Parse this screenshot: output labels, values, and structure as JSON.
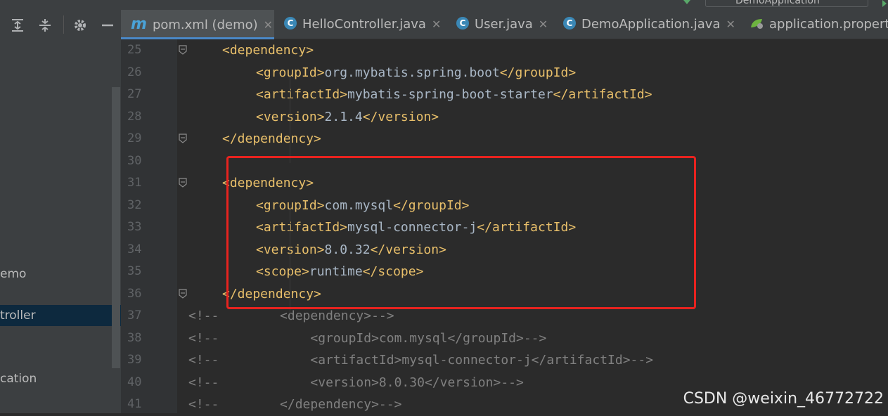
{
  "run_config": "DemoApplication",
  "project_tree": {
    "items": [
      {
        "label": "emo",
        "selected": false
      },
      {
        "label": "troller",
        "selected": true
      },
      {
        "label": "cation",
        "selected": false
      }
    ]
  },
  "tabs": [
    {
      "label": "pom.xml (demo)",
      "icon": "maven-icon",
      "active": true
    },
    {
      "label": "HelloController.java",
      "icon": "class-icon",
      "active": false
    },
    {
      "label": "User.java",
      "icon": "class-icon",
      "active": false
    },
    {
      "label": "DemoApplication.java",
      "icon": "spring-class-icon",
      "active": false
    },
    {
      "label": "application.propert",
      "icon": "spring-properties-icon",
      "active": false
    }
  ],
  "editor": {
    "lines": [
      {
        "num": "25",
        "indent": 4,
        "parts": [
          [
            "tag",
            "<dependency>"
          ]
        ]
      },
      {
        "num": "26",
        "indent": 8,
        "parts": [
          [
            "tag",
            "<groupId>"
          ],
          [
            "txt",
            "org.mybatis.spring.boot"
          ],
          [
            "tag",
            "</groupId>"
          ]
        ]
      },
      {
        "num": "27",
        "indent": 8,
        "parts": [
          [
            "tag",
            "<artifactId>"
          ],
          [
            "txt",
            "mybatis-spring-boot-starter"
          ],
          [
            "tag",
            "</artifactId>"
          ]
        ]
      },
      {
        "num": "28",
        "indent": 8,
        "parts": [
          [
            "tag",
            "<version>"
          ],
          [
            "txt",
            "2.1.4"
          ],
          [
            "tag",
            "</version>"
          ]
        ]
      },
      {
        "num": "29",
        "indent": 4,
        "parts": [
          [
            "tag",
            "</dependency>"
          ]
        ]
      },
      {
        "num": "30",
        "indent": 0,
        "parts": []
      },
      {
        "num": "31",
        "indent": 4,
        "parts": [
          [
            "tag",
            "<dependency>"
          ]
        ]
      },
      {
        "num": "32",
        "indent": 8,
        "parts": [
          [
            "tag",
            "<groupId>"
          ],
          [
            "txt",
            "com.mysql"
          ],
          [
            "tag",
            "</groupId>"
          ]
        ]
      },
      {
        "num": "33",
        "indent": 8,
        "parts": [
          [
            "tag",
            "<artifactId>"
          ],
          [
            "txt",
            "mysql-connector-j"
          ],
          [
            "tag",
            "</artifactId>"
          ]
        ]
      },
      {
        "num": "34",
        "indent": 8,
        "parts": [
          [
            "tag",
            "<version>"
          ],
          [
            "txt",
            "8.0.32"
          ],
          [
            "tag",
            "</version>"
          ]
        ]
      },
      {
        "num": "35",
        "indent": 8,
        "parts": [
          [
            "tag",
            "<scope>"
          ],
          [
            "txt",
            "runtime"
          ],
          [
            "tag",
            "</scope>"
          ]
        ]
      },
      {
        "num": "36",
        "indent": 4,
        "parts": [
          [
            "tag",
            "</dependency>"
          ]
        ]
      },
      {
        "num": "37",
        "indent": 0,
        "parts": [
          [
            "cmt",
            "<!--        <dependency>-->"
          ]
        ]
      },
      {
        "num": "38",
        "indent": 0,
        "parts": [
          [
            "cmt",
            "<!--            <groupId>com.mysql</groupId>-->"
          ]
        ]
      },
      {
        "num": "39",
        "indent": 0,
        "parts": [
          [
            "cmt",
            "<!--            <artifactId>mysql-connector-j</artifactId>-->"
          ]
        ]
      },
      {
        "num": "40",
        "indent": 0,
        "parts": [
          [
            "cmt",
            "<!--            <version>8.0.30</version>-->"
          ]
        ]
      },
      {
        "num": "41",
        "indent": 0,
        "parts": [
          [
            "cmt",
            "<!--        </dependency>-->"
          ]
        ]
      }
    ],
    "fold_markers": [
      "25",
      "29",
      "31",
      "36"
    ]
  },
  "watermark": "CSDN @weixin_46772722",
  "colors": {
    "tag": "#e8bf6a",
    "text": "#a9b7c6",
    "comment": "#808080",
    "highlight_box": "#e8231f"
  }
}
